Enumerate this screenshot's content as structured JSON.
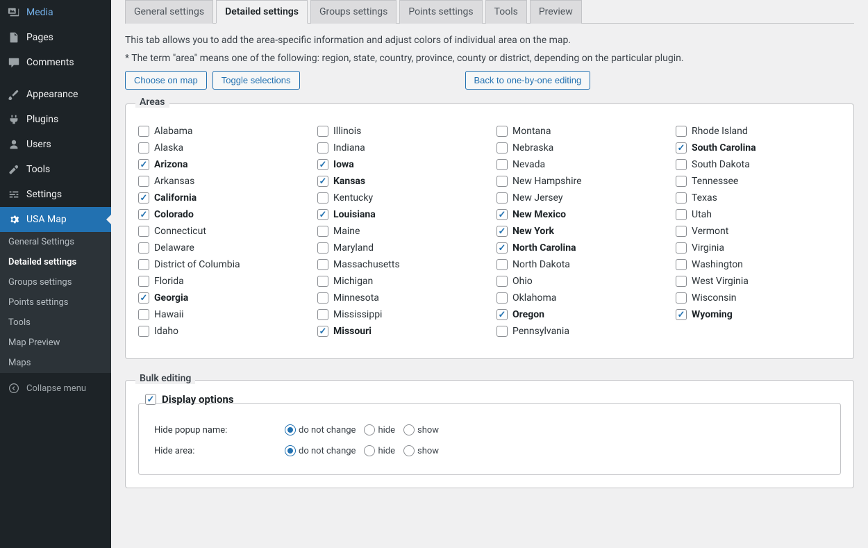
{
  "sidebar": {
    "menu": [
      {
        "id": "media",
        "label": "Media",
        "icon": "media"
      },
      {
        "id": "pages",
        "label": "Pages",
        "icon": "page"
      },
      {
        "id": "comments",
        "label": "Comments",
        "icon": "comment"
      },
      {
        "sep": true
      },
      {
        "id": "appearance",
        "label": "Appearance",
        "icon": "brush"
      },
      {
        "id": "plugins",
        "label": "Plugins",
        "icon": "plug"
      },
      {
        "id": "users",
        "label": "Users",
        "icon": "user"
      },
      {
        "id": "tools",
        "label": "Tools",
        "icon": "wrench"
      },
      {
        "id": "settings",
        "label": "Settings",
        "icon": "sliders"
      },
      {
        "id": "usa-map",
        "label": "USA Map",
        "icon": "gear",
        "active": true
      }
    ],
    "submenu": [
      {
        "label": "General Settings"
      },
      {
        "label": "Detailed settings",
        "active": true
      },
      {
        "label": "Groups settings"
      },
      {
        "label": "Points settings"
      },
      {
        "label": "Tools"
      },
      {
        "label": "Map Preview"
      },
      {
        "label": "Maps"
      }
    ],
    "collapse": "Collapse menu"
  },
  "tabs": [
    {
      "id": "general",
      "label": "General settings"
    },
    {
      "id": "detailed",
      "label": "Detailed settings",
      "active": true
    },
    {
      "id": "groups",
      "label": "Groups settings"
    },
    {
      "id": "points",
      "label": "Points settings"
    },
    {
      "id": "tools",
      "label": "Tools"
    },
    {
      "id": "preview",
      "label": "Preview"
    }
  ],
  "description": {
    "line1": "This tab allows you to add the area-specific information and adjust colors of individual area on the map.",
    "line2": "* The term \"area\" means one of the following: region, state, country, province, county or district, depending on the particular plugin."
  },
  "buttons": {
    "choose": "Choose on map",
    "toggle": "Toggle selections",
    "back": "Back to one-by-one editing"
  },
  "areas": {
    "legend": "Areas",
    "columns": [
      [
        {
          "name": "Alabama",
          "checked": false
        },
        {
          "name": "Alaska",
          "checked": false
        },
        {
          "name": "Arizona",
          "checked": true
        },
        {
          "name": "Arkansas",
          "checked": false
        },
        {
          "name": "California",
          "checked": true
        },
        {
          "name": "Colorado",
          "checked": true
        },
        {
          "name": "Connecticut",
          "checked": false
        },
        {
          "name": "Delaware",
          "checked": false
        },
        {
          "name": "District of Columbia",
          "checked": false
        },
        {
          "name": "Florida",
          "checked": false
        },
        {
          "name": "Georgia",
          "checked": true
        },
        {
          "name": "Hawaii",
          "checked": false
        },
        {
          "name": "Idaho",
          "checked": false
        }
      ],
      [
        {
          "name": "Illinois",
          "checked": false
        },
        {
          "name": "Indiana",
          "checked": false
        },
        {
          "name": "Iowa",
          "checked": true
        },
        {
          "name": "Kansas",
          "checked": true
        },
        {
          "name": "Kentucky",
          "checked": false
        },
        {
          "name": "Louisiana",
          "checked": true
        },
        {
          "name": "Maine",
          "checked": false
        },
        {
          "name": "Maryland",
          "checked": false
        },
        {
          "name": "Massachusetts",
          "checked": false
        },
        {
          "name": "Michigan",
          "checked": false
        },
        {
          "name": "Minnesota",
          "checked": false
        },
        {
          "name": "Mississippi",
          "checked": false
        },
        {
          "name": "Missouri",
          "checked": true
        }
      ],
      [
        {
          "name": "Montana",
          "checked": false
        },
        {
          "name": "Nebraska",
          "checked": false
        },
        {
          "name": "Nevada",
          "checked": false
        },
        {
          "name": "New Hampshire",
          "checked": false
        },
        {
          "name": "New Jersey",
          "checked": false
        },
        {
          "name": "New Mexico",
          "checked": true
        },
        {
          "name": "New York",
          "checked": true
        },
        {
          "name": "North Carolina",
          "checked": true
        },
        {
          "name": "North Dakota",
          "checked": false
        },
        {
          "name": "Ohio",
          "checked": false
        },
        {
          "name": "Oklahoma",
          "checked": false
        },
        {
          "name": "Oregon",
          "checked": true
        },
        {
          "name": "Pennsylvania",
          "checked": false
        }
      ],
      [
        {
          "name": "Rhode Island",
          "checked": false
        },
        {
          "name": "South Carolina",
          "checked": true
        },
        {
          "name": "South Dakota",
          "checked": false
        },
        {
          "name": "Tennessee",
          "checked": false
        },
        {
          "name": "Texas",
          "checked": false
        },
        {
          "name": "Utah",
          "checked": false
        },
        {
          "name": "Vermont",
          "checked": false
        },
        {
          "name": "Virginia",
          "checked": false
        },
        {
          "name": "Washington",
          "checked": false
        },
        {
          "name": "West Virginia",
          "checked": false
        },
        {
          "name": "Wisconsin",
          "checked": false
        },
        {
          "name": "Wyoming",
          "checked": true
        }
      ]
    ]
  },
  "bulk": {
    "legend": "Bulk editing",
    "display_options_title": "Display options",
    "display_options_checked": true,
    "rows": [
      {
        "label": "Hide popup name:",
        "options": [
          "do not change",
          "hide",
          "show"
        ],
        "selected": 0
      },
      {
        "label": "Hide area:",
        "options": [
          "do not change",
          "hide",
          "show"
        ],
        "selected": 0
      }
    ]
  }
}
